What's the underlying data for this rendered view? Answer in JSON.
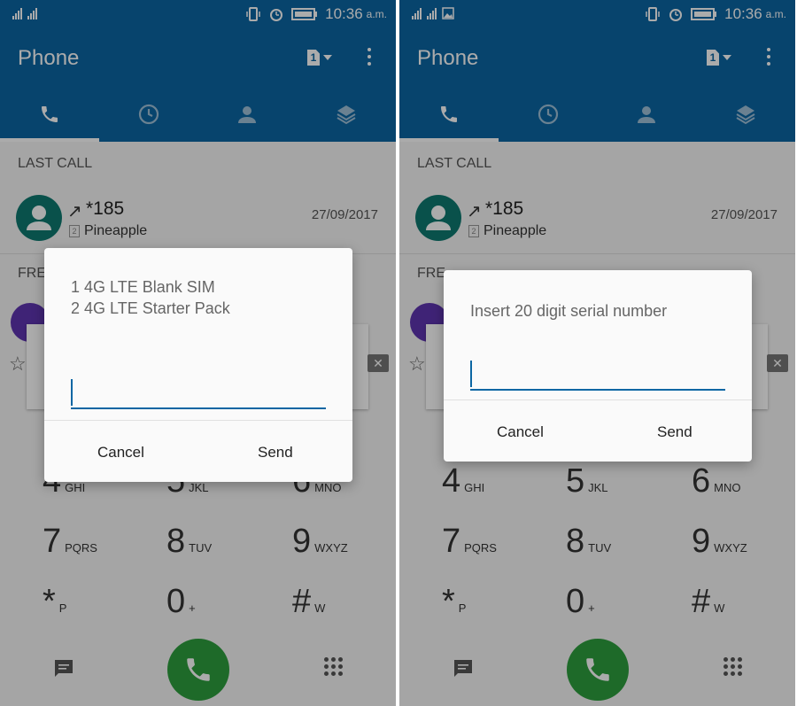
{
  "screens": [
    {
      "status": {
        "time": "10:36",
        "ampm": "a.m."
      },
      "app_title": "Phone",
      "sim_label": "1",
      "recent": {
        "section_label": "LAST CALL",
        "number": "*185",
        "carrier": "Pineapple",
        "sim_slot": "2",
        "date": "27/09/2017"
      },
      "section2_label": "FRE",
      "keypad": [
        {
          "digit": "4",
          "letters": "GHI"
        },
        {
          "digit": "5",
          "letters": "JKL"
        },
        {
          "digit": "6",
          "letters": "MNO"
        },
        {
          "digit": "7",
          "letters": "PQRS"
        },
        {
          "digit": "8",
          "letters": "TUV"
        },
        {
          "digit": "9",
          "letters": "WXYZ"
        },
        {
          "digit": "*",
          "letters": "P"
        },
        {
          "digit": "0",
          "letters": "+"
        },
        {
          "digit": "#",
          "letters": "W"
        }
      ],
      "dialog": {
        "message": "1 4G LTE Blank SIM\n2 4G LTE Starter Pack",
        "input_value": "",
        "cancel": "Cancel",
        "send": "Send"
      }
    },
    {
      "status": {
        "time": "10:36",
        "ampm": "a.m."
      },
      "app_title": "Phone",
      "sim_label": "1",
      "recent": {
        "section_label": "LAST CALL",
        "number": "*185",
        "carrier": "Pineapple",
        "sim_slot": "2",
        "date": "27/09/2017"
      },
      "section2_label": "FRE",
      "keypad": [
        {
          "digit": "4",
          "letters": "GHI"
        },
        {
          "digit": "5",
          "letters": "JKL"
        },
        {
          "digit": "6",
          "letters": "MNO"
        },
        {
          "digit": "7",
          "letters": "PQRS"
        },
        {
          "digit": "8",
          "letters": "TUV"
        },
        {
          "digit": "9",
          "letters": "WXYZ"
        },
        {
          "digit": "*",
          "letters": "P"
        },
        {
          "digit": "0",
          "letters": "+"
        },
        {
          "digit": "#",
          "letters": "W"
        }
      ],
      "dialog": {
        "message": "Insert 20 digit serial number",
        "input_value": "",
        "cancel": "Cancel",
        "send": "Send"
      }
    }
  ],
  "colors": {
    "primary": "#0b66a3",
    "call_green": "#2e9e3e",
    "avatar_teal": "#0e7a70"
  },
  "icons": [
    "signal-icon",
    "sd-card-icon",
    "vibrate-icon",
    "alarm-icon",
    "battery-icon",
    "phone-icon",
    "clock-icon",
    "person-icon",
    "layers-icon",
    "overflow-icon",
    "message-icon",
    "dialpad-icon",
    "star-icon",
    "clear-icon"
  ]
}
